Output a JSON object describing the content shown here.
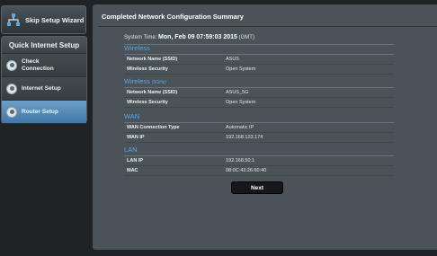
{
  "sidebar": {
    "skip_label": "Skip Setup Wizard",
    "qis_title": "Quick Internet Setup",
    "items": [
      {
        "line1": "Check",
        "line2": "Connection"
      },
      {
        "line1": "Internet Setup",
        "line2": ""
      },
      {
        "line1": "Router Setup",
        "line2": ""
      }
    ],
    "active_index": 2
  },
  "main": {
    "title": "Completed Network Configuration Summary",
    "systime_label": "System Time:",
    "systime_value": "Mon, Feb 09 07:59:03 2015",
    "systime_tz": "(GMT)",
    "sections": [
      {
        "title": "Wireless",
        "subtitle": "",
        "rows": [
          {
            "k": "Network Name (SSID)",
            "v": "ASUS"
          },
          {
            "k": "Wireless Security",
            "v": "Open System"
          }
        ]
      },
      {
        "title": "Wireless",
        "subtitle": "(5GHz)",
        "rows": [
          {
            "k": "Network Name (SSID)",
            "v": "ASUS_5G"
          },
          {
            "k": "Wireless Security",
            "v": "Open System"
          }
        ]
      },
      {
        "title": "WAN",
        "subtitle": "",
        "rows": [
          {
            "k": "WAN Connection Type",
            "v": "Automatic IP"
          },
          {
            "k": "WAN IP",
            "v": "192.168.123.174"
          }
        ]
      },
      {
        "title": "LAN",
        "subtitle": "",
        "rows": [
          {
            "k": "LAN IP",
            "v": "192.168.50.1"
          },
          {
            "k": "MAC",
            "v": "08:0C:43:26:60:40"
          }
        ]
      }
    ],
    "next_label": "Next"
  },
  "colors": {
    "accent": "#5aa8e6",
    "active_item": "#4f86b4",
    "panel": "#4a5357",
    "background": "#1f2326"
  },
  "icons": [
    "network-icon",
    "radio-dot-icon"
  ]
}
